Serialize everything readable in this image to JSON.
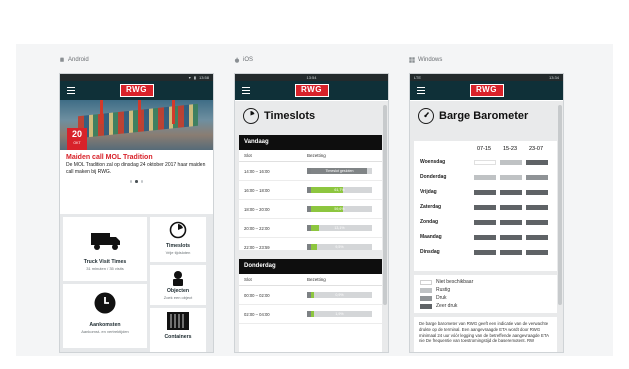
{
  "platforms": {
    "android": "Android",
    "ios": "iOS",
    "windows": "Windows"
  },
  "android": {
    "status": "13:58",
    "logo": "RWG",
    "news": {
      "date_day": "20",
      "date_month": "OKT",
      "title": "Maiden call MOL Tradition",
      "text": "De MOL Tradition zal op dinsdag 24 oktober 2017 haar maiden call maken bij RWG."
    },
    "tiles": {
      "truck": {
        "title": "Truck Visit Times",
        "sub": "31 minuten / 35 visits"
      },
      "timeslots": {
        "title": "Timeslots",
        "sub": "Vrije tijdsloten"
      },
      "arrivals": {
        "title": "Aankomsten",
        "sub": "Aankomst- en vertrektijden"
      },
      "objects": {
        "title": "Objecten",
        "sub": "Zoek een object"
      },
      "containers": {
        "title": "Containers",
        "sub": ""
      }
    }
  },
  "ios": {
    "status": "13:54",
    "logo": "RWG",
    "title": "Timeslots",
    "days": [
      {
        "name": "Vandaag",
        "col_slot": "Slot",
        "col_occupancy": "Bezetting",
        "rows": [
          {
            "slot": "14:00 – 16:00",
            "fill": 0.92,
            "label": "Timeslot gesloten",
            "color": "#808486"
          },
          {
            "slot": "16:00 – 18:00",
            "fill": 0.55,
            "label": "61,7%",
            "color": "#8dc63f"
          },
          {
            "slot": "18:00 – 20:00",
            "fill": 0.55,
            "label": "59,6%",
            "color": "#8dc63f"
          },
          {
            "slot": "20:00 – 22:00",
            "fill": 0.18,
            "label": "13,1%",
            "color": "#8dc63f"
          },
          {
            "slot": "22:00 – 23:59",
            "fill": 0.16,
            "label": "9,5%",
            "color": "#8dc63f"
          }
        ]
      },
      {
        "name": "Donderdag",
        "col_slot": "Slot",
        "col_occupancy": "Bezetting",
        "rows": [
          {
            "slot": "00:00 – 02:00",
            "fill": 0.1,
            "label": "0,9%",
            "color": "#8dc63f"
          },
          {
            "slot": "02:00 – 04:00",
            "fill": 0.11,
            "label": "1,9%",
            "color": "#8dc63f"
          }
        ]
      }
    ]
  },
  "windows": {
    "status_left": "LTE",
    "status_right": "13:34",
    "logo": "RWG",
    "title": "Barge Barometer",
    "time_headers": [
      "07-15",
      "15-23",
      "23-07"
    ],
    "days": [
      "Woensdag",
      "Donderdag",
      "Vrijdag",
      "Zaterdag",
      "Zondag",
      "Maandag",
      "Dinsdag"
    ],
    "levels": [
      [
        "none",
        "quiet",
        "heavy"
      ],
      [
        "quiet",
        "quiet",
        "busy"
      ],
      [
        "heavy",
        "heavy",
        "heavy"
      ],
      [
        "heavy",
        "heavy",
        "heavy"
      ],
      [
        "heavy",
        "heavy",
        "heavy"
      ],
      [
        "heavy",
        "heavy",
        "heavy"
      ],
      [
        "heavy",
        "heavy",
        "heavy"
      ]
    ],
    "level_colors": {
      "none": "#ffffff",
      "quiet": "#bfc2c4",
      "busy": "#8f9396",
      "heavy": "#5f6366"
    },
    "legend": [
      {
        "key": "none",
        "label": "Niet beschikbaar"
      },
      {
        "key": "quiet",
        "label": "Rustig"
      },
      {
        "key": "busy",
        "label": "Druk"
      },
      {
        "key": "heavy",
        "label": "Zeer druk"
      }
    ],
    "description": "De barge barometer van RWG geeft een indicatie van de verwachte drukte op de terminal. Een aangevraagde ETA wordt door RWG minimaal 24 uur vóór legging van de betreffende aangevraagde ETA nie De frequentie van toestromingstijd de baseremotent. RW"
  }
}
